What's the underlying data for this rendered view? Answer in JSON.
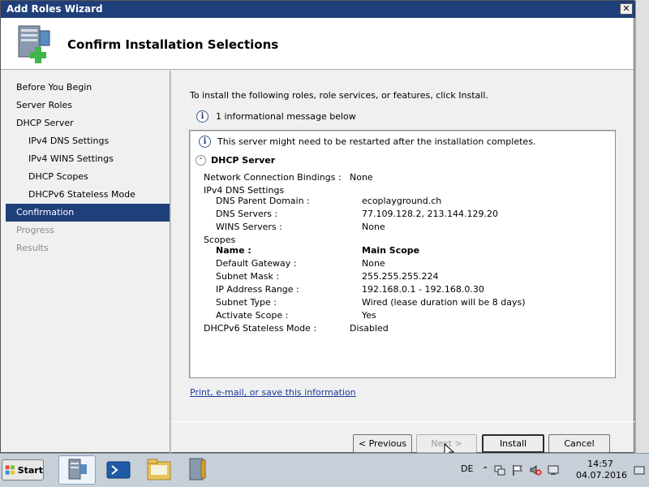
{
  "window": {
    "title": "Add Roles Wizard",
    "close_label": "✕"
  },
  "header": {
    "title": "Confirm Installation Selections"
  },
  "nav": {
    "items": [
      {
        "label": "Before You Begin",
        "level": "top",
        "state": "normal"
      },
      {
        "label": "Server Roles",
        "level": "top",
        "state": "normal"
      },
      {
        "label": "DHCP Server",
        "level": "top",
        "state": "normal"
      },
      {
        "label": "IPv4 DNS Settings",
        "level": "sub",
        "state": "normal"
      },
      {
        "label": "IPv4 WINS Settings",
        "level": "sub",
        "state": "normal"
      },
      {
        "label": "DHCP Scopes",
        "level": "sub",
        "state": "normal"
      },
      {
        "label": "DHCPv6 Stateless Mode",
        "level": "sub",
        "state": "normal"
      },
      {
        "label": "Confirmation",
        "level": "top",
        "state": "active"
      },
      {
        "label": "Progress",
        "level": "top",
        "state": "disabled"
      },
      {
        "label": "Results",
        "level": "top",
        "state": "disabled"
      }
    ]
  },
  "main": {
    "intro": "To install the following roles, role services, or features, click Install.",
    "info_count": "1 informational message below",
    "restart_msg": "This server might need to be restarted after the installation completes.",
    "section_title": "DHCP Server",
    "details": {
      "ncb_label": "Network Connection Bindings :",
      "ncb_value": "None",
      "ipv4dns_label": "IPv4 DNS Settings",
      "dns_parent_label": "DNS Parent Domain :",
      "dns_parent_value": "ecoplayground.ch",
      "dns_servers_label": "DNS Servers :",
      "dns_servers_value": "77.109.128.2, 213.144.129.20",
      "wins_label": "WINS Servers :",
      "wins_value": "None",
      "scopes_label": "Scopes",
      "name_label": "Name :",
      "name_value": "Main Scope",
      "gateway_label": "Default Gateway :",
      "gateway_value": "None",
      "mask_label": "Subnet Mask :",
      "mask_value": "255.255.255.224",
      "range_label": "IP Address Range :",
      "range_value": "192.168.0.1 - 192.168.0.30",
      "type_label": "Subnet Type :",
      "type_value": "Wired (lease duration will be 8 days)",
      "activate_label": "Activate Scope :",
      "activate_value": "Yes",
      "v6_label": "DHCPv6 Stateless Mode :",
      "v6_value": "Disabled"
    },
    "link": "Print, e-mail, or save this information"
  },
  "buttons": {
    "previous": "< Previous",
    "next": "Next >",
    "install": "Install",
    "cancel": "Cancel"
  },
  "taskbar": {
    "start": "Start",
    "lang": "DE",
    "time": "14:57",
    "date": "04.07.2016"
  },
  "colors": {
    "title_bar": "#1f3f7a",
    "nav_active": "#1f3f7a",
    "link": "#1a3a9a"
  }
}
